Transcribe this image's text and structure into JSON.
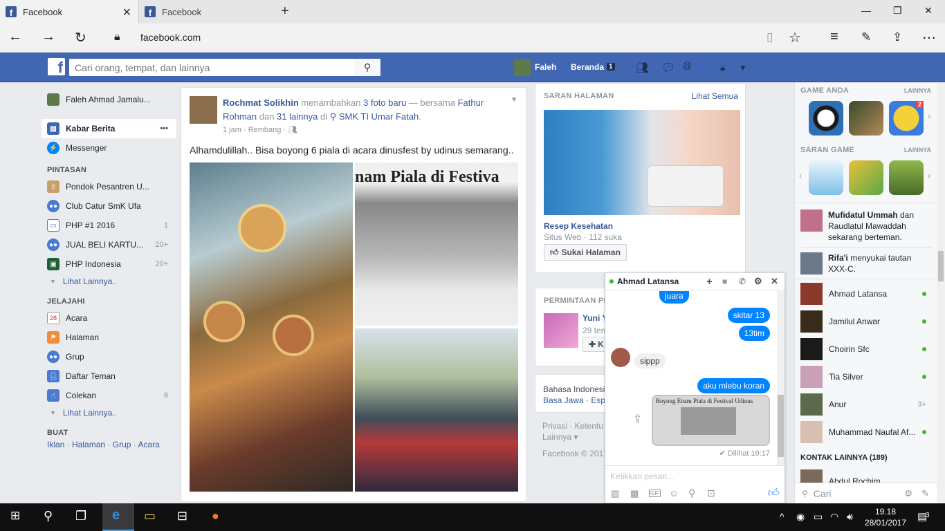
{
  "browser": {
    "tabs": [
      {
        "label": "Facebook",
        "active": true
      },
      {
        "label": "Facebook",
        "active": false
      }
    ],
    "url": "facebook.com"
  },
  "fb_header": {
    "search_placeholder": "Cari orang, tempat, dan lainnya",
    "profile_name": "Faleh",
    "home_label": "Beranda",
    "home_count": "1"
  },
  "left_nav": {
    "profile": "Faleh Ahmad Jamalu...",
    "items_main": [
      {
        "label": "Kabar Berita",
        "more": "•••"
      },
      {
        "label": "Messenger"
      }
    ],
    "shortcuts_heading": "PINTASAN",
    "shortcuts": [
      {
        "label": "Pondok Pesantren U...",
        "count": ""
      },
      {
        "label": "Club Catur SmK Ufa",
        "count": ""
      },
      {
        "label": "PHP #1 2016",
        "count": "1"
      },
      {
        "label": "JUAL BELI KARTU...",
        "count": "20+"
      },
      {
        "label": "PHP Indonesia",
        "count": "20+"
      }
    ],
    "see_more_1": "Lihat Lainnya..",
    "explore_heading": "JELAJAHI",
    "explore": [
      {
        "label": "Acara",
        "count": ""
      },
      {
        "label": "Halaman",
        "count": ""
      },
      {
        "label": "Grup",
        "count": ""
      },
      {
        "label": "Daftar Teman",
        "count": ""
      },
      {
        "label": "Colekan",
        "count": "6"
      }
    ],
    "see_more_2": "Lihat Lainnya..",
    "create_heading": "BUAT",
    "create_links": [
      "Iklan",
      "Halaman",
      "Grup",
      "Acara"
    ]
  },
  "post": {
    "author": "Rochmat Solikhin",
    "action": " menambahkan ",
    "photos": "3 foto baru",
    "with": " — bersama ",
    "tagged": "Fathur Rohman",
    "and": " dan ",
    "others": "31 lainnya",
    "at": " di ",
    "location": "SMK TI Umar Fatah",
    "time": "1 jam",
    "place": "Rembang",
    "text": "Alhamdulillah.. Bisa boyong 6 piala di acara dinusfest by udinus semarang..",
    "newspaper_headline": "nam Piala di Festiva"
  },
  "suggested_pages": {
    "heading": "SARAN HALAMAN",
    "see_all": "Lihat Semua",
    "page_name": "Resep Kesehatan",
    "page_meta": "Situs Web · 112 suka",
    "like_button": "Sukai Halaman"
  },
  "friend_requests": {
    "heading": "PERMINTAAN PE",
    "name": "Yuni Y",
    "meta": "29 tem",
    "button": "K"
  },
  "language": {
    "line1": "Bahasa Indonesi",
    "line2": "Basa Jawa · Esp"
  },
  "footer": {
    "line1": "Privasi · Ketentu",
    "line2": "Lainnya ▾",
    "copyright": "Facebook © 2017"
  },
  "sidebar": {
    "games_heading": "GAME ANDA",
    "games_more": "LAINNYA",
    "game_badge": "2",
    "suggest_heading": "SARAN GAME",
    "suggest_more": "LAINNYA",
    "ticker": [
      {
        "bold": "Mufidatul Ummah",
        "rest": " dan Raudlatul Mawaddah sekarang berteman."
      },
      {
        "bold": "Rifa'i",
        "rest": " menyukai tautan XXX-C."
      }
    ],
    "contacts": [
      {
        "name": "Ahmad Latansa",
        "status": "online"
      },
      {
        "name": "Jamilul Anwar",
        "status": "online"
      },
      {
        "name": "Choirin Sfc",
        "status": "online"
      },
      {
        "name": "Tia Silver",
        "status": "online"
      },
      {
        "name": "Anur",
        "status": "3+"
      },
      {
        "name": "Muhammad Naufal Af...",
        "status": "online"
      }
    ],
    "more_contacts": "KONTAK LAINNYA (189)",
    "next_contact": "Abdul Rochim",
    "search_placeholder": "Cari"
  },
  "chat": {
    "name": "Ahmad Latansa",
    "messages": [
      {
        "from": "me",
        "text": "juara"
      },
      {
        "from": "me",
        "text": "skitar 13"
      },
      {
        "from": "me",
        "text": "13tim"
      },
      {
        "from": "them",
        "text": "sippp"
      },
      {
        "from": "me",
        "text": "aku mlebu koran"
      }
    ],
    "image_caption": "Boyong Enam Piala di Festival Udinus",
    "seen": "Dilihat 19:17",
    "input_placeholder": "Ketikkan pesan..."
  },
  "taskbar": {
    "time": "19.18",
    "date": "28/01/2017",
    "notif_count": "3"
  },
  "colors": {
    "fb_blue": "#4267b2",
    "link": "#365899",
    "messenger_blue": "#0084ff",
    "online": "#42b72a"
  }
}
